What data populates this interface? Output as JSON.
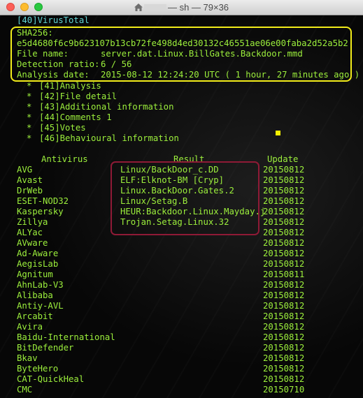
{
  "window": {
    "title_host": "",
    "title_text": "— sh — 79×36"
  },
  "header": {
    "section": "[40]VirusTotal",
    "sha_label": "SHA256:",
    "sha_value": "e5d4680f6c9b623107b13cb72fe498d4ed30132c46551ae06e00faba2d52a5b2",
    "file_label": "File name:",
    "file_value": "server.dat.Linux.BillGates.Backdoor.mmd",
    "ratio_label": "Detection ratio:",
    "ratio_value": "6 / 56",
    "date_label": "Analysis date:",
    "date_value": "2015-08-12 12:24:20 UTC ( 1 hour, 27 minutes ago )"
  },
  "menu": [
    {
      "bullet": "*",
      "label": "[41]Analysis"
    },
    {
      "bullet": "*",
      "label": "[42]File detail"
    },
    {
      "bullet": "*",
      "label": "[43]Additional information"
    },
    {
      "bullet": "*",
      "label": "[44]Comments 1"
    },
    {
      "bullet": "*",
      "label": "[45]Votes"
    },
    {
      "bullet": "*",
      "label": "[46]Behavioural information"
    }
  ],
  "table": {
    "headers": {
      "antivirus": "Antivirus",
      "result": "Result",
      "update": "Update"
    },
    "rows": [
      {
        "antivirus": "AVG",
        "result": "Linux/BackDoor_c.DD",
        "update": "20150812"
      },
      {
        "antivirus": "Avast",
        "result": "ELF:Elknot-BM [Cryp]",
        "update": "20150812"
      },
      {
        "antivirus": "DrWeb",
        "result": "Linux.BackDoor.Gates.2",
        "update": "20150812"
      },
      {
        "antivirus": "ESET-NOD32",
        "result": "Linux/Setag.B",
        "update": "20150812"
      },
      {
        "antivirus": "Kaspersky",
        "result": "HEUR:Backdoor.Linux.Mayday.j",
        "update": "20150812"
      },
      {
        "antivirus": "Zillya",
        "result": "Trojan.Setag.Linux.32",
        "update": "20150812"
      },
      {
        "antivirus": "ALYac",
        "result": "",
        "update": "20150812"
      },
      {
        "antivirus": "AVware",
        "result": "",
        "update": "20150812"
      },
      {
        "antivirus": "Ad-Aware",
        "result": "",
        "update": "20150812"
      },
      {
        "antivirus": "AegisLab",
        "result": "",
        "update": "20150812"
      },
      {
        "antivirus": "Agnitum",
        "result": "",
        "update": "20150811"
      },
      {
        "antivirus": "AhnLab-V3",
        "result": "",
        "update": "20150812"
      },
      {
        "antivirus": "Alibaba",
        "result": "",
        "update": "20150812"
      },
      {
        "antivirus": "Antiy-AVL",
        "result": "",
        "update": "20150812"
      },
      {
        "antivirus": "Arcabit",
        "result": "",
        "update": "20150812"
      },
      {
        "antivirus": "Avira",
        "result": "",
        "update": "20150812"
      },
      {
        "antivirus": "Baidu-International",
        "result": "",
        "update": "20150812"
      },
      {
        "antivirus": "BitDefender",
        "result": "",
        "update": "20150812"
      },
      {
        "antivirus": "Bkav",
        "result": "",
        "update": "20150812"
      },
      {
        "antivirus": "ByteHero",
        "result": "",
        "update": "20150812"
      },
      {
        "antivirus": "CAT-QuickHeal",
        "result": "",
        "update": "20150812"
      },
      {
        "antivirus": "CMC",
        "result": "",
        "update": "20150710"
      }
    ]
  },
  "colors": {
    "terminal_text": "#9cef3c",
    "section_link": "#62d4d4",
    "highlight_box_top": "#f2ec1a",
    "highlight_box_results": "#8f1a36",
    "cursor": "#f4f100"
  }
}
